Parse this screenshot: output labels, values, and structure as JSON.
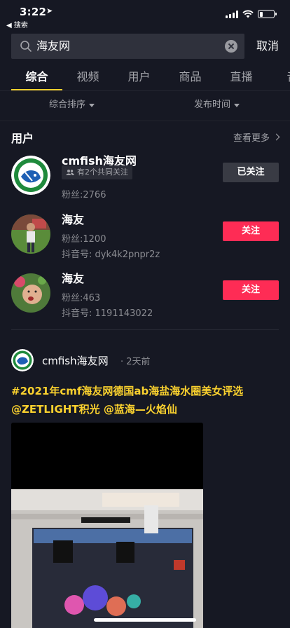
{
  "status": {
    "time": "3:22",
    "back_app": "◀ 搜索"
  },
  "search": {
    "query": "海友网",
    "cancel_label": "取消"
  },
  "tabs": [
    {
      "label": "综合",
      "active": true
    },
    {
      "label": "视频",
      "active": false
    },
    {
      "label": "用户",
      "active": false
    },
    {
      "label": "商品",
      "active": false
    },
    {
      "label": "直播",
      "active": false
    },
    {
      "label": "音",
      "active": false
    }
  ],
  "filters": {
    "sort_label": "综合排序",
    "time_label": "发布时间"
  },
  "users_section": {
    "title": "用户",
    "see_more": "查看更多",
    "users": [
      {
        "name": "cmfish海友网",
        "mutual": "有2个共同关注",
        "fans": "粉丝:2766",
        "id": "",
        "button": "已关注"
      },
      {
        "name": "海友",
        "fans": "粉丝:1200",
        "id": "抖音号: dyk4k2pnpr2z",
        "button": "关注"
      },
      {
        "name": "海友",
        "fans": "粉丝:463",
        "id": "抖音号: 1191143022",
        "button": "关注"
      }
    ]
  },
  "post": {
    "author": "cmfish海友网",
    "time": "· 2天前",
    "line1": "#2021年cmf海友网德国ab海盐海水圈美女评选",
    "line2": "@ZETLIGHT积光 @蓝海—火焰仙"
  },
  "colors": {
    "background": "#161823",
    "accent_yellow": "#fad12e",
    "follow_red": "#fe2c55",
    "followed_gray": "#393b44"
  }
}
